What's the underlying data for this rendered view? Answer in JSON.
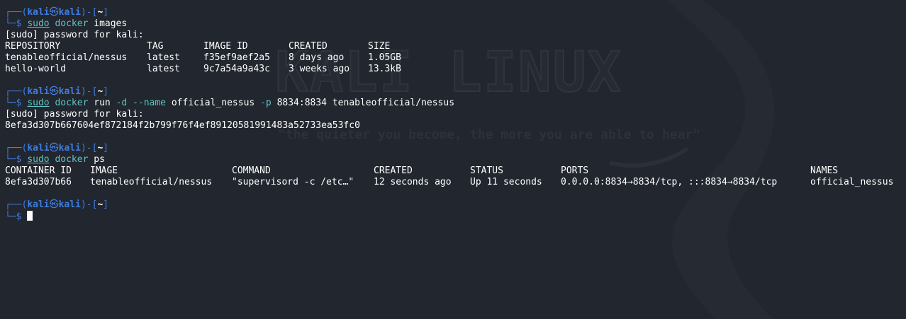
{
  "prompt": {
    "corner_top": "┌──(",
    "user": "kali",
    "skull": "㉿",
    "host": "kali",
    "close_host": ")-[",
    "dir": "~",
    "close_dir": "]",
    "corner_bottom": "└─",
    "dollar": "$"
  },
  "wallpaper": {
    "title": "KALI LINUX",
    "tagline": "\"the quieter you become, the more you are able to hear\""
  },
  "block1": {
    "cmd_sudo": "sudo",
    "cmd_main": "docker",
    "cmd_args": "images",
    "sudo_prompt": "[sudo] password for kali:",
    "headers": [
      "REPOSITORY",
      "TAG",
      "IMAGE ID",
      "CREATED",
      "SIZE"
    ],
    "rows": [
      [
        "tenableofficial/nessus",
        "latest",
        "f35ef9aef2a5",
        "8 days ago",
        "1.05GB"
      ],
      [
        "hello-world",
        "latest",
        "9c7a54a9a43c",
        "3 weeks ago",
        "13.3kB"
      ]
    ]
  },
  "block2": {
    "cmd_sudo": "sudo",
    "cmd_main": "docker",
    "cmd_run": "run",
    "opt_d": "-d",
    "opt_name": "--name",
    "name_val": "official_nessus",
    "opt_p": "-p",
    "port_val": "8834:8834",
    "image": "tenableofficial/nessus",
    "sudo_prompt": "[sudo] password for kali:",
    "container_hash": "8efa3d307b667604ef872184f2b799f76f4ef89120581991483a52733ea53fc0"
  },
  "block3": {
    "cmd_sudo": "sudo",
    "cmd_main": "docker",
    "cmd_args": "ps",
    "headers": [
      "CONTAINER ID",
      "IMAGE",
      "COMMAND",
      "CREATED",
      "STATUS",
      "PORTS",
      "NAMES"
    ],
    "rows": [
      [
        "8efa3d307b66",
        "tenableofficial/nessus",
        "\"supervisord -c /etc…\"",
        "12 seconds ago",
        "Up 11 seconds",
        "0.0.0.0:8834→8834/tcp, :::8834→8834/tcp",
        "official_nessus"
      ]
    ]
  },
  "colors": {
    "background": "#22262e",
    "prompt_blue": "#3f7de0",
    "command_cyan": "#5ec4c2",
    "text": "#ffffff"
  }
}
